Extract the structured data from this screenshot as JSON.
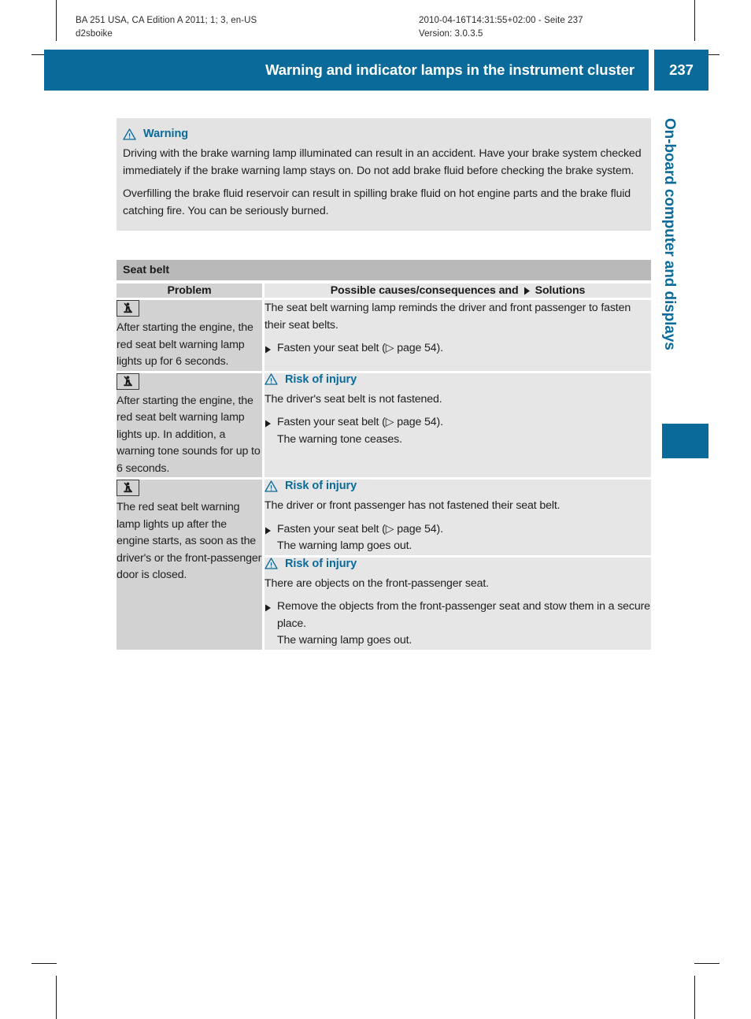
{
  "meta": {
    "left_line1": "BA 251 USA, CA Edition A 2011; 1; 3, en-US",
    "left_line2": "d2sboike",
    "right_line1": "2010-04-16T14:31:55+02:00 - Seite 237",
    "right_line2": "Version: 3.0.3.5"
  },
  "header": {
    "title": "Warning and indicator lamps in the instrument cluster",
    "page_number": "237",
    "accent_color": "#0a6b9a"
  },
  "side_tab": {
    "chapter": "On-board computer and displays"
  },
  "warning_box": {
    "icon": "warning-triangle-icon",
    "title": "Warning",
    "paragraphs": [
      "Driving with the brake warning lamp illuminated can result in an accident. Have your brake system checked immediately if the brake warning lamp stays on. Do not add brake fluid before checking the brake system.",
      "Overfilling the brake fluid reservoir can result in spilling brake fluid on hot engine parts and the brake fluid catching fire. You can be seriously burned."
    ]
  },
  "section": {
    "title": "Seat belt"
  },
  "table": {
    "headers": {
      "problem": "Problem",
      "solutions_before": "Possible causes/consequences and",
      "solutions_marker": "solid-triangle-icon",
      "solutions_after": "Solutions"
    },
    "rows": [
      {
        "problem_icon": "seat-belt-warning-lamp-icon",
        "problem_text": "After starting the engine, the red seat belt warning lamp lights up for 6 seconds.",
        "blocks": [
          {
            "note_title": null,
            "paragraph": "The seat belt warning lamp reminds the driver and front passenger to fasten their seat belts.",
            "steps": [
              {
                "main": "Fasten your seat belt (▷ page 54).",
                "sub": null
              }
            ]
          }
        ]
      },
      {
        "problem_icon": "seat-belt-warning-lamp-icon",
        "problem_text": "After starting the engine, the red seat belt warning lamp lights up. In addition, a warning tone sounds for up to 6 seconds.",
        "blocks": [
          {
            "note_title": "Risk of injury",
            "paragraph": "The driver's seat belt is not fastened.",
            "steps": [
              {
                "main": "Fasten your seat belt (▷ page 54).",
                "sub": "The warning tone ceases."
              }
            ]
          }
        ]
      },
      {
        "problem_icon": "seat-belt-warning-lamp-icon",
        "problem_text": "The red seat belt warning lamp lights up after the engine starts, as soon as the driver's or the front-passenger door is closed.",
        "blocks": [
          {
            "note_title": "Risk of injury",
            "paragraph": "The driver or front passenger has not fastened their seat belt.",
            "steps": [
              {
                "main": "Fasten your seat belt (▷ page 54).",
                "sub": "The warning lamp goes out."
              }
            ]
          },
          {
            "note_title": "Risk of injury",
            "paragraph": "There are objects on the front-passenger seat.",
            "steps": [
              {
                "main": "Remove the objects from the front-passenger seat and stow them in a secure place.",
                "sub": "The warning lamp goes out."
              }
            ]
          }
        ]
      }
    ]
  }
}
